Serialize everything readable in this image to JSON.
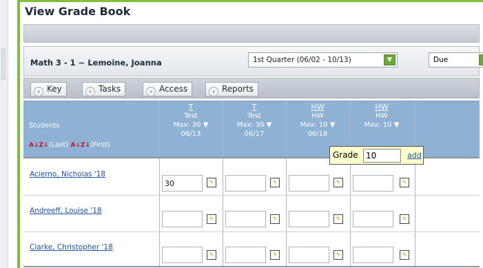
{
  "page": {
    "title": "View Grade Book"
  },
  "course": {
    "name": "Math 3 - 1 ~ Lemoine, Joanna",
    "period_select": "1st Quarter (06/02 - 10/13)",
    "sort_select": "Due"
  },
  "toolbar": {
    "key": "Key",
    "tasks": "Tasks",
    "access": "Access",
    "reports": "Reports"
  },
  "grid": {
    "students_label": "Students",
    "sort_last": "(Last)",
    "sort_first": "(First)",
    "sort_glyph": "A↓Z↓",
    "columns": [
      {
        "code": "T",
        "type": "Test",
        "max": "Max: 30",
        "date": "06/13"
      },
      {
        "code": "T",
        "type": "Test",
        "max": "Max: 30",
        "date": "06/17"
      },
      {
        "code": "HW",
        "type": "HW",
        "max": "Max: 10",
        "date": "06/18"
      },
      {
        "code": "HW",
        "type": "HW",
        "max": "Max: 10",
        "date": ""
      }
    ],
    "rows": [
      {
        "name": "Acierno, Nicholas '18",
        "grades": [
          "30",
          "",
          "",
          ""
        ]
      },
      {
        "name": "Andreeff, Louise '18",
        "grades": [
          "",
          "",
          "",
          ""
        ]
      },
      {
        "name": "Clarke, Christopher '18",
        "grades": [
          "",
          "",
          "",
          ""
        ]
      }
    ]
  },
  "popup": {
    "label": "Grade",
    "value": "10",
    "action": "add"
  },
  "colors": {
    "accent_green": "#7fbd3a",
    "header_blue": "#8fb1d3",
    "link_blue": "#1f4fa6"
  }
}
